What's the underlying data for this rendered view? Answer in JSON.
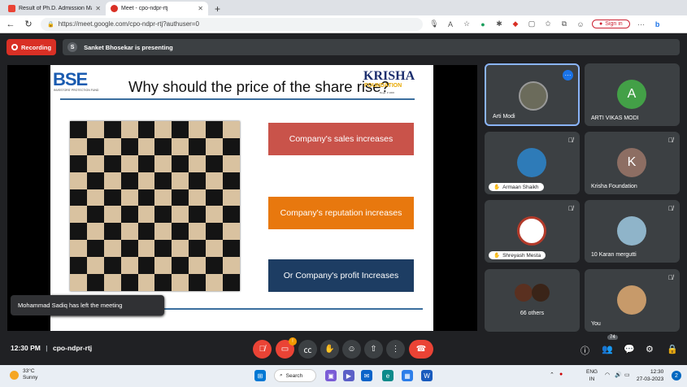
{
  "browser": {
    "tabs": [
      {
        "label": "Result of Ph.D. Admission March",
        "icon_color": "#ea4335",
        "active": false
      },
      {
        "label": "Meet - cpo-ndpr-rtj",
        "icon_color": "#d93025",
        "active": true
      }
    ],
    "url": "https://meet.google.com/cpo-ndpr-rtj?authuser=0",
    "signin_label": "Sign in"
  },
  "meet_header": {
    "recording_label": "Recording",
    "presenter_initial": "S",
    "presenting_text": "Sanket Bhosekar is presenting"
  },
  "slide": {
    "logo_left": "BSE",
    "logo_left_sub": "INVESTORS' PROTECTION FUND",
    "logo_right": "KRISHA",
    "logo_right_sub": "FOUNDATION",
    "logo_right_tag": "Regd. # 1000",
    "title": "Why should the price of the share rise?",
    "boxes": [
      {
        "text": "Company's sales increases",
        "color": "#c9534a"
      },
      {
        "text": "Company's reputation increases",
        "color": "#e8780e"
      },
      {
        "text": "Or Company's profit Increases",
        "color": "#1d3d63"
      }
    ]
  },
  "toast": "Mohammad Sadiq has left the meeting",
  "participants": [
    {
      "name": "Arti Modi",
      "type": "photo",
      "color": "#6b6b5b"
    },
    {
      "name": "ARTI VIKAS MODI",
      "type": "initial",
      "initial": "A",
      "color": "#43a047"
    },
    {
      "name": "Armaan Shaikh",
      "type": "photo",
      "color": "#2e7bb8"
    },
    {
      "name": "Krisha Foundation",
      "type": "initial",
      "initial": "K",
      "color": "#8d6e63"
    },
    {
      "name": "Shreyash Mesta",
      "type": "photo",
      "color": "#b33a2a"
    },
    {
      "name": "10 Karan mergutti",
      "type": "photo",
      "color": "#8fb4c9"
    },
    {
      "name": "66 others",
      "type": "group",
      "color": "#5a3020"
    },
    {
      "name": "You",
      "type": "photo",
      "color": "#c79a6a"
    }
  ],
  "controls": {
    "time": "12:30 PM",
    "separator": "|",
    "meeting_code": "cpo-ndpr-rtj",
    "people_count": "74",
    "raise_badge": "!"
  },
  "taskbar": {
    "temp": "33°C",
    "weather": "Sunny",
    "search_label": "Search",
    "lang": "ENG",
    "region": "IN",
    "time": "12:30",
    "date": "27-03-2023",
    "notif": "2"
  }
}
